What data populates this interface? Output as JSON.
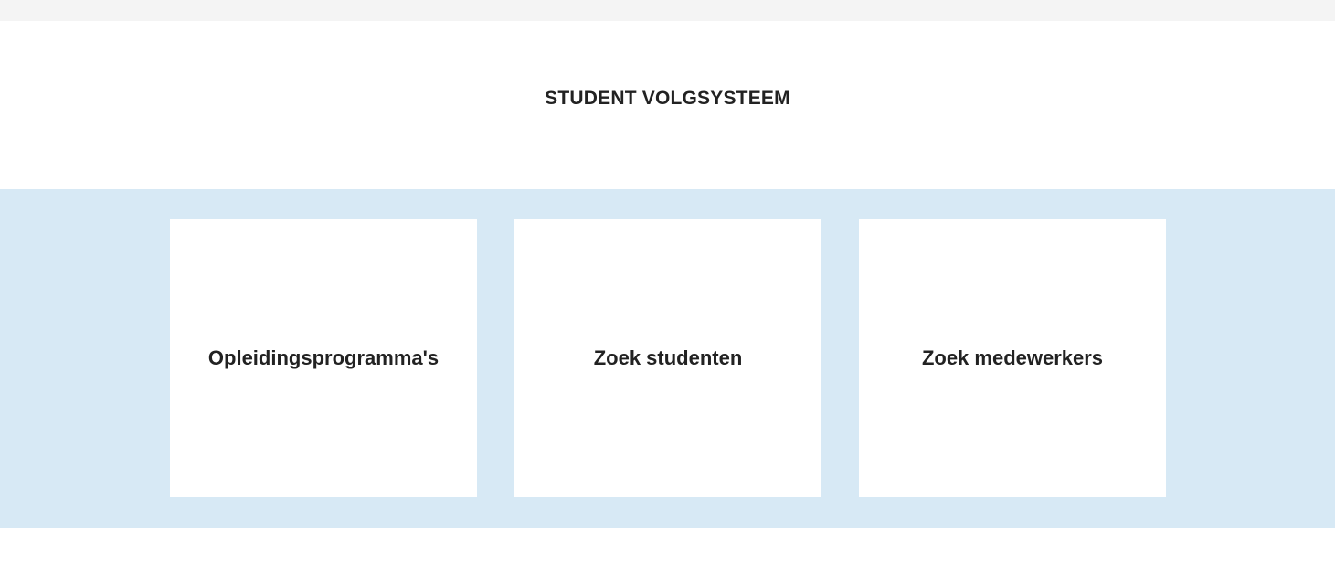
{
  "header": {
    "title": "STUDENT VOLGSYSTEEM"
  },
  "tiles": [
    {
      "label": "Opleidingsprogramma's"
    },
    {
      "label": "Zoek studenten"
    },
    {
      "label": "Zoek medewerkers"
    }
  ],
  "colors": {
    "top_bar": "#f4f4f4",
    "tiles_band": "#d7e9f5",
    "tile_background": "#ffffff",
    "text": "#222222"
  }
}
